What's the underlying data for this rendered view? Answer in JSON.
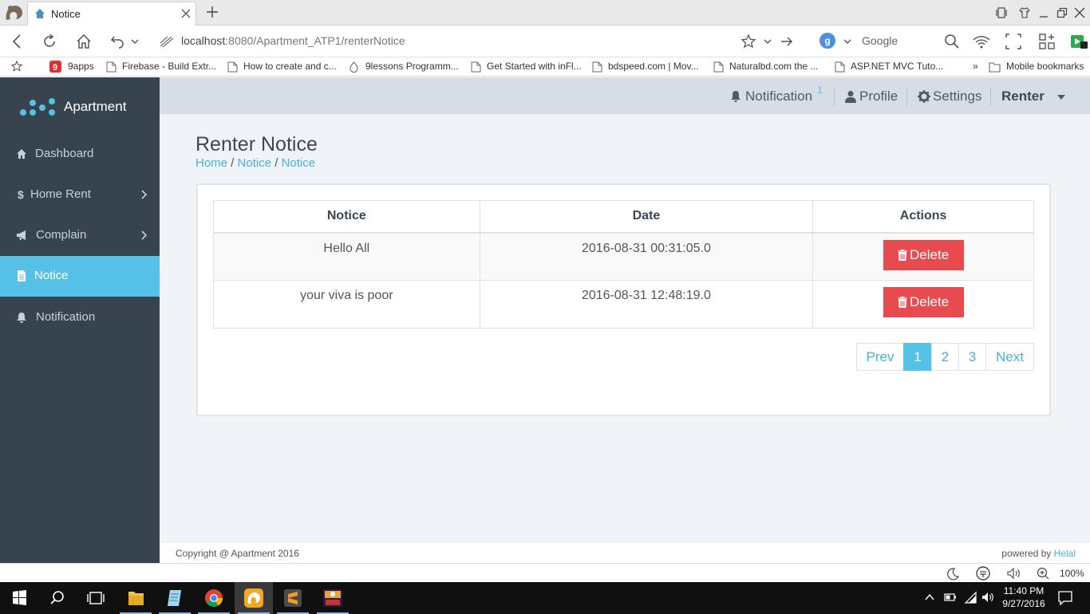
{
  "browser": {
    "tab_title": "Notice",
    "url_host": "localhost",
    "url_rest": ":8080/Apartment_ATP1/renterNotice",
    "search_engine_letter": "g",
    "search_placeholder": "Google",
    "zoom": "100%",
    "bookmarks": [
      {
        "label": "9apps",
        "icon": "9apps-icon"
      },
      {
        "label": "Firebase - Build Extr...",
        "icon": "page-icon"
      },
      {
        "label": "How to create and c...",
        "icon": "page-icon"
      },
      {
        "label": "9lessons Programm...",
        "icon": "drop-icon"
      },
      {
        "label": "Get Started with inFl...",
        "icon": "page-icon"
      },
      {
        "label": "bdspeed.com | Mov...",
        "icon": "page-icon"
      },
      {
        "label": "Naturalbd.com the ...",
        "icon": "page-icon"
      },
      {
        "label": "ASP.NET MVC Tuto...",
        "icon": "page-icon"
      }
    ],
    "bookmarks_more": "»",
    "mobile_bookmarks": "Mobile bookmarks"
  },
  "app": {
    "brand": "Apartment",
    "sidebar": [
      {
        "label": "Dashboard",
        "icon": "home-icon"
      },
      {
        "label": "Home Rent",
        "icon": "dollar-icon"
      },
      {
        "label": "Complain",
        "icon": "bullhorn-icon"
      },
      {
        "label": "Notice",
        "icon": "file-icon"
      },
      {
        "label": "Notification",
        "icon": "bell-icon"
      }
    ],
    "topbar": {
      "notification": "Notification",
      "notification_count": "1",
      "profile": "Profile",
      "settings": "Settings",
      "user": "Renter"
    },
    "page_title": "Renter Notice",
    "breadcrumb": [
      "Home",
      "Notice",
      "Notice"
    ],
    "table": {
      "headers": [
        "Notice",
        "Date",
        "Actions"
      ],
      "rows": [
        {
          "notice": "Hello All",
          "date": "2016-08-31 00:31:05.0",
          "action": "Delete"
        },
        {
          "notice": "your viva is poor",
          "date": "2016-08-31 12:48:19.0",
          "action": "Delete"
        }
      ]
    },
    "pagination": [
      "Prev",
      "1",
      "2",
      "3",
      "Next"
    ],
    "pagination_active": "1",
    "footer_left": "Copyright @ Apartment 2016",
    "footer_right_prefix": "powered by ",
    "footer_right_link": "Helal"
  },
  "taskbar": {
    "time": "11:40 PM",
    "date": "9/27/2016"
  },
  "colors": {
    "sidebar": "#37434f",
    "accent": "#56c1e7",
    "danger": "#e84b4f"
  }
}
